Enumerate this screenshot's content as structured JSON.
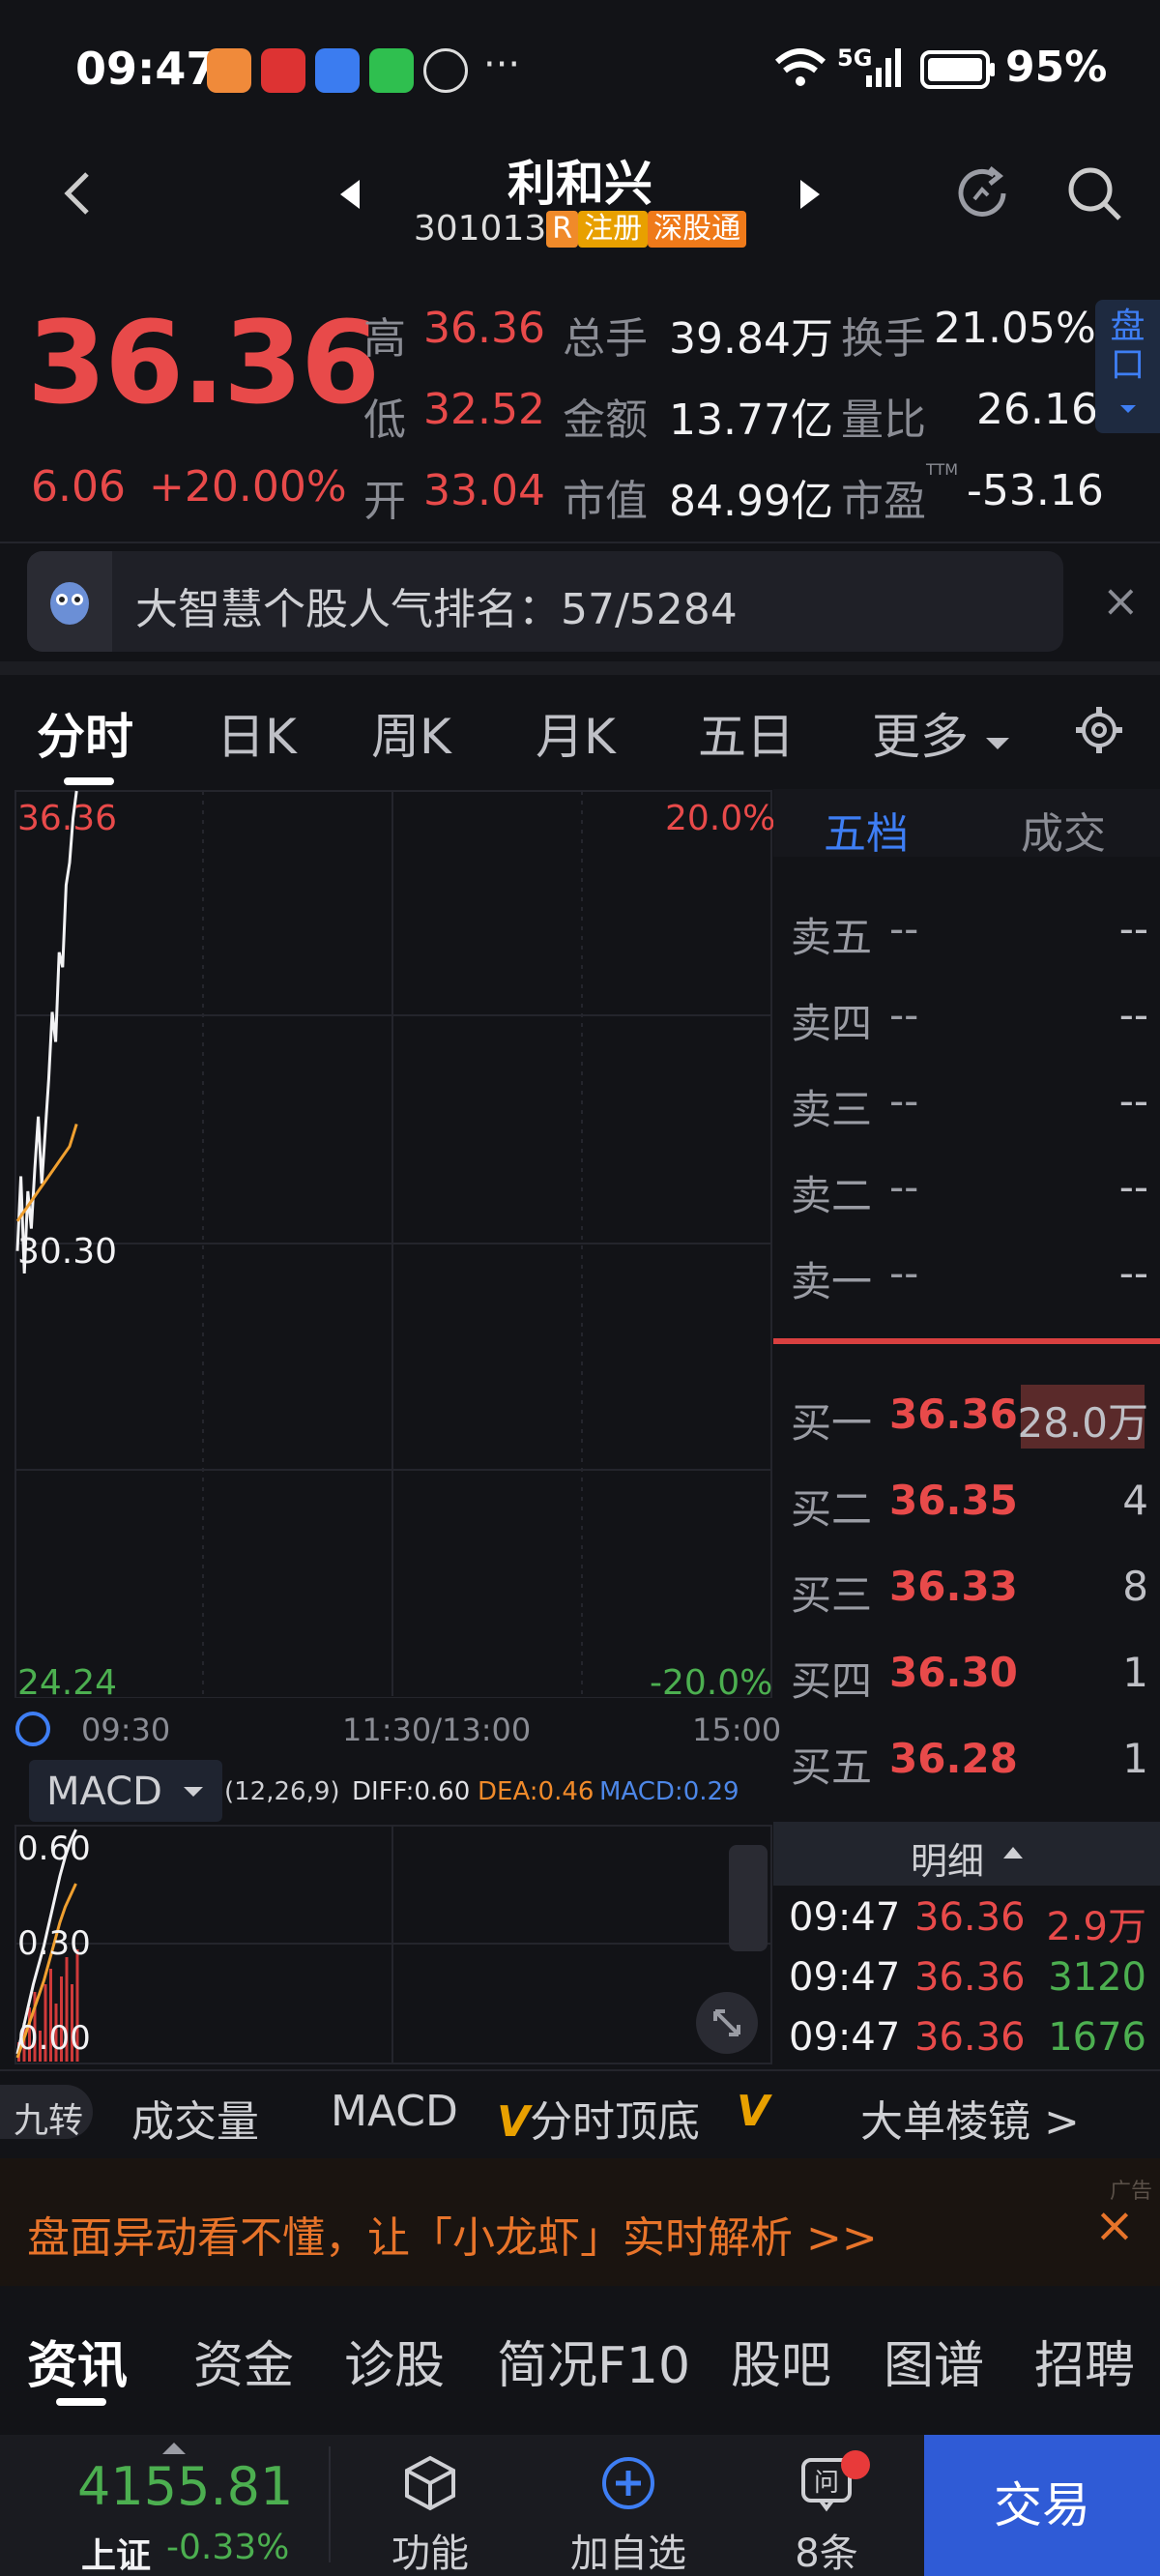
{
  "status_bar": {
    "time": "09:47",
    "network": "5G",
    "battery": "95%",
    "more": "···"
  },
  "header": {
    "back_icon": "chevron-left-icon",
    "prev_icon": "triangle-left-icon",
    "next_icon": "triangle-right-icon",
    "stock_name": "利和兴",
    "stock_code": "301013",
    "tags": [
      "R",
      "注册",
      "深股通"
    ],
    "refresh_icon": "refresh-icon",
    "search_icon": "search-icon"
  },
  "quote": {
    "price": "36.36",
    "change": "6.06",
    "change_pct": "+20.00%",
    "high_label": "高",
    "high": "36.36",
    "low_label": "低",
    "low": "32.52",
    "open_label": "开",
    "open": "33.04",
    "volume_label": "总手",
    "volume": "39.84万",
    "amount_label": "金额",
    "amount": "13.77亿",
    "mktcap_label": "市值",
    "mktcap": "84.99亿",
    "turnover_label": "换手",
    "turnover": "21.05%",
    "vol_ratio_label": "量比",
    "vol_ratio": "26.16",
    "pe_label": "市盈",
    "pe_mark": "TTM",
    "pe": "-53.16",
    "side_tab": "盘口"
  },
  "banner": {
    "text": "大智慧个股人气排名：57/5284",
    "close": "×"
  },
  "chart_tabs": [
    "分时",
    "日K",
    "周K",
    "月K",
    "五日",
    "更多"
  ],
  "chart": {
    "y_top": "36.36",
    "y_mid": "30.30",
    "y_bottom": "24.24",
    "pct_top": "20.0%",
    "pct_bottom": "-20.0%",
    "x_labels": [
      "09:30",
      "11:30/13:00",
      "15:00"
    ]
  },
  "macd": {
    "selector": "MACD",
    "params": "(12,26,9)",
    "diff": "DIFF:0.60",
    "dea": "DEA:0.46",
    "macd": "MACD:0.29",
    "y_labels": [
      "0.60",
      "0.30",
      "0.00"
    ]
  },
  "chart_data": [
    {
      "type": "line",
      "title": "",
      "xlabel": "",
      "ylabel": "",
      "x_ticks": [
        "09:30",
        "11:30/13:00",
        "15:00"
      ],
      "ylim": [
        24.24,
        36.36
      ],
      "series": [
        {
          "name": "",
          "x": [
            0,
            1,
            2,
            3,
            4,
            5,
            6,
            7,
            8,
            9,
            10,
            11,
            12,
            13,
            14,
            15,
            16,
            17
          ],
          "values": [
            30.2,
            31.2,
            29.9,
            31.0,
            30.5,
            31.3,
            32.0,
            31.1,
            31.8,
            32.5,
            33.4,
            33.0,
            34.2,
            34.0,
            35.1,
            35.4,
            36.0,
            36.36
          ]
        },
        {
          "name": "",
          "x": [
            0,
            3,
            6,
            9,
            12,
            15,
            17
          ],
          "values": [
            30.6,
            30.8,
            31.0,
            31.2,
            31.4,
            31.6,
            31.9
          ]
        }
      ]
    },
    {
      "type": "bar",
      "title": "MACD",
      "ylim": [
        0,
        0.6
      ],
      "series": [
        {
          "name": "MACD",
          "values": [
            0.05,
            0.1,
            0.14,
            0.18,
            0.08,
            0.2,
            0.24,
            0.15,
            0.22,
            0.27,
            0.2,
            0.29
          ]
        },
        {
          "name": "DIFF",
          "values": [
            0.02,
            0.08,
            0.14,
            0.2,
            0.25,
            0.3,
            0.36,
            0.42,
            0.48,
            0.53,
            0.57,
            0.6
          ]
        },
        {
          "name": "DEA",
          "values": [
            0.01,
            0.05,
            0.09,
            0.13,
            0.17,
            0.21,
            0.26,
            0.31,
            0.36,
            0.4,
            0.43,
            0.46
          ]
        }
      ]
    }
  ],
  "orderbook": {
    "tab_active": "五档",
    "tab_other": "成交",
    "asks": [
      {
        "label": "卖五",
        "price": "--",
        "vol": "--"
      },
      {
        "label": "卖四",
        "price": "--",
        "vol": "--"
      },
      {
        "label": "卖三",
        "price": "--",
        "vol": "--"
      },
      {
        "label": "卖二",
        "price": "--",
        "vol": "--"
      },
      {
        "label": "卖一",
        "price": "--",
        "vol": "--"
      }
    ],
    "bids": [
      {
        "label": "买一",
        "price": "36.36",
        "vol": "28.0万"
      },
      {
        "label": "买二",
        "price": "36.35",
        "vol": "4"
      },
      {
        "label": "买三",
        "price": "36.33",
        "vol": "8"
      },
      {
        "label": "买四",
        "price": "36.30",
        "vol": "1"
      },
      {
        "label": "买五",
        "price": "36.28",
        "vol": "1"
      }
    ],
    "detail_label": "明细",
    "details": [
      {
        "time": "09:47",
        "price": "36.36",
        "vol": "2.9万"
      },
      {
        "time": "09:47",
        "price": "36.36",
        "vol": "3120"
      },
      {
        "time": "09:47",
        "price": "36.36",
        "vol": "1676"
      }
    ]
  },
  "indicator_tabs": {
    "nine": "九转",
    "volume": "成交量",
    "macd": "MACD",
    "top_bottom": "分时顶底",
    "big_order": "大单棱镜 >"
  },
  "ad": {
    "label": "广告",
    "text": "盘面异动看不懂，让「小龙虾」实时解析 >>",
    "close": "×"
  },
  "news_tabs": [
    "资讯",
    "资金",
    "诊股",
    "简况F10",
    "股吧",
    "图谱",
    "招聘"
  ],
  "bottom_bar": {
    "index_value": "4155.81",
    "index_name": "上证",
    "index_change": "-0.33%",
    "func": "功能",
    "add": "加自选",
    "msgs": "8条",
    "trade": "交易"
  }
}
